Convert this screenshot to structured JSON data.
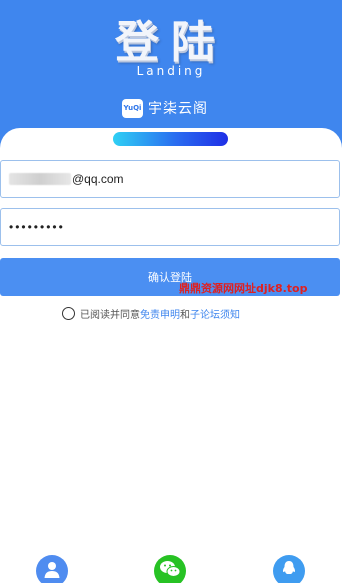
{
  "header": {
    "title": "登陆",
    "subtitle": "Landing",
    "brand_badge": "YuQi",
    "brand_name": "宇柒云阁"
  },
  "form": {
    "email_suffix": "@qq.com",
    "password_masked": "•••••••••",
    "login_button": "确认登陆"
  },
  "watermark": "鼎鼎资源网网址djk8.top",
  "agreement": {
    "prefix": "已阅读并同意",
    "link1": "免责申明",
    "conjunction": "和",
    "link2": "子论坛须知"
  },
  "social": {
    "icons": [
      "user-icon",
      "wechat-icon",
      "qq-icon"
    ]
  },
  "colors": {
    "header_blue": "#3f86ee",
    "button_blue": "#4b8ff2",
    "link_blue": "#3f86ee",
    "watermark_red": "#e02020",
    "wechat_green": "#27c224"
  }
}
